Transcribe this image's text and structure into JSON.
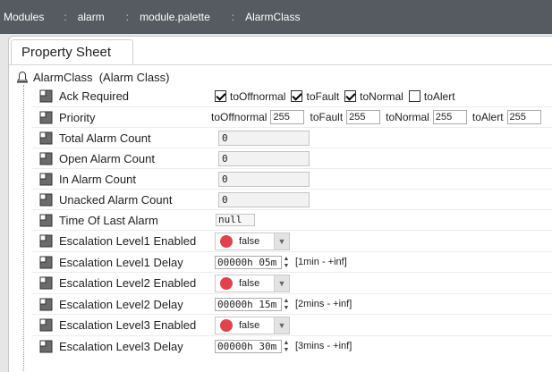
{
  "breadcrumbs": [
    {
      "label": "Modules"
    },
    {
      "label": "alarm"
    },
    {
      "label": "module.palette"
    },
    {
      "label": "AlarmClass"
    }
  ],
  "tab": {
    "label": "Property Sheet"
  },
  "root": {
    "name": "AlarmClass",
    "type": "(Alarm Class)"
  },
  "properties": {
    "ack_required": {
      "label": "Ack Required",
      "options": [
        {
          "label": "toOffnormal",
          "checked": true
        },
        {
          "label": "toFault",
          "checked": true
        },
        {
          "label": "toNormal",
          "checked": true
        },
        {
          "label": "toAlert",
          "checked": false
        }
      ]
    },
    "priority": {
      "label": "Priority",
      "fields": [
        {
          "label": "toOffnormal",
          "value": "255"
        },
        {
          "label": "toFault",
          "value": "255"
        },
        {
          "label": "toNormal",
          "value": "255"
        },
        {
          "label": "toAlert",
          "value": "255"
        }
      ]
    },
    "total_alarm_count": {
      "label": "Total Alarm Count",
      "value": "0"
    },
    "open_alarm_count": {
      "label": "Open Alarm Count",
      "value": "0"
    },
    "in_alarm_count": {
      "label": "In Alarm Count",
      "value": "0"
    },
    "unacked_alarm_count": {
      "label": "Unacked Alarm Count",
      "value": "0"
    },
    "time_of_last_alarm": {
      "label": "Time Of Last Alarm",
      "value": "null"
    },
    "escalation_level1_enabled": {
      "label": "Escalation Level1 Enabled",
      "value": "false"
    },
    "escalation_level1_delay": {
      "label": "Escalation Level1 Delay",
      "value": "00000h 05m",
      "range": "[1min - +inf]"
    },
    "escalation_level2_enabled": {
      "label": "Escalation Level2 Enabled",
      "value": "false"
    },
    "escalation_level2_delay": {
      "label": "Escalation Level2 Delay",
      "value": "00000h 15m",
      "range": "[2mins - +inf]"
    },
    "escalation_level3_enabled": {
      "label": "Escalation Level3 Enabled",
      "value": "false"
    },
    "escalation_level3_delay": {
      "label": "Escalation Level3 Delay",
      "value": "00000h 30m",
      "range": "[3mins - +inf]"
    }
  },
  "colors": {
    "topbar": "#555b61",
    "false_dot": "#e0434d"
  },
  "icons": {
    "root": "bell-icon",
    "property": "property-slot-icon",
    "dropdown": "chevron-down-icon",
    "spinner": "spinner-arrows-icon"
  }
}
